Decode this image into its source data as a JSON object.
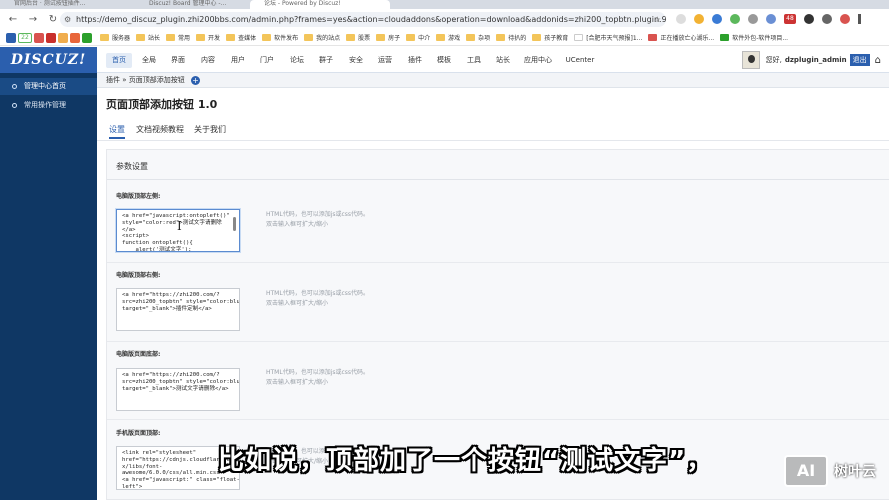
{
  "browser": {
    "tabs": [
      "官网后台 · 测试按钮插件...",
      "Discuz! Board 管理中心 -...",
      "论坛 - Powered by Discuz!"
    ],
    "url": "https://demo_discuz_plugin.zhi200bbs.com/admin.php?frames=yes&action=cloudaddons&operation=download&addonids=zhi200_topbtn.plugin.98386&md5hash=5b2522a...",
    "ext_badge": "48"
  },
  "bookmarks": {
    "icons_text": [
      "22"
    ],
    "items": [
      "服务器",
      "站长",
      "常用",
      "开发",
      "查媒体",
      "软件发布",
      "我的站点",
      "股票",
      "房子",
      "中介",
      "游戏",
      "杂项",
      "待扒的",
      "孩子教育",
      "[合肥市天气预报]1...",
      "正在播放亡心湖乐...",
      "软件外包-软件项目..."
    ]
  },
  "sidebar": {
    "logo": "DISCUZ!",
    "items": [
      "管理中心首页",
      "常用操作管理"
    ]
  },
  "topnav": {
    "items": [
      "首页",
      "全局",
      "界面",
      "内容",
      "用户",
      "门户",
      "论坛",
      "群子",
      "安全",
      "运营",
      "插件",
      "模板",
      "工具",
      "站长",
      "应用中心",
      "UCenter"
    ],
    "greeting": "您好,",
    "username": "dzplugin_admin",
    "logout": "退出"
  },
  "breadcrumb": {
    "text": "插件 » 页面顶部添加按钮"
  },
  "page": {
    "title": "页面顶部添加按钮 1.0",
    "tabs": [
      "设置",
      "文档视频教程",
      "关于我们"
    ],
    "section_title": "参数设置"
  },
  "fields": [
    {
      "label": "电脑版顶部左侧:",
      "value": "<a href=\"javascript:ontopleft()\"\nstyle=\"color:red\">测试文字请删除\n</a>\n<script>\nfunction ontopleft(){\n    alert('测试文字');",
      "hint1": "HTML代码，也可以添加js或css代码。",
      "hint2": "双击输入框可扩大/缩小"
    },
    {
      "label": "电脑版顶部右侧:",
      "value": "<a href=\"https://zhi200.com/?\nsrc=zhi200_topbtn\" style=\"color:blue\"\ntarget=\"_blank\">插件定制</a>",
      "hint1": "HTML代码，也可以添加js或css代码。",
      "hint2": "双击输入框可扩大/缩小"
    },
    {
      "label": "电脑版页面底部:",
      "value": "<a href=\"https://zhi200.com/?\nsrc=zhi200_topbtn\" style=\"color:blue\"\ntarget=\"_blank\">测试文字请删除</a>",
      "hint1": "HTML代码，也可以添加js或css代码。",
      "hint2": "双击输入框可扩大/缩小"
    },
    {
      "label": "手机版页面顶部:",
      "value": "<link rel=\"stylesheet\"\nhref=\"https://cdnjs.cloudflare.com/aja\nx/libs/font-\nawesome/6.0.0/css/all.min.css\">\n<a href=\"javascript:\" class=\"float-\nleft\">",
      "hint1": "HTML代码，也可以添加js或css代码。",
      "hint2": "双击输入框可扩大/缩小"
    }
  ],
  "overlay": {
    "subtitle": "比如说，顶部加了一个按钮“测试文字”，",
    "watermark_box": "AI",
    "watermark_text": "树叶云"
  }
}
